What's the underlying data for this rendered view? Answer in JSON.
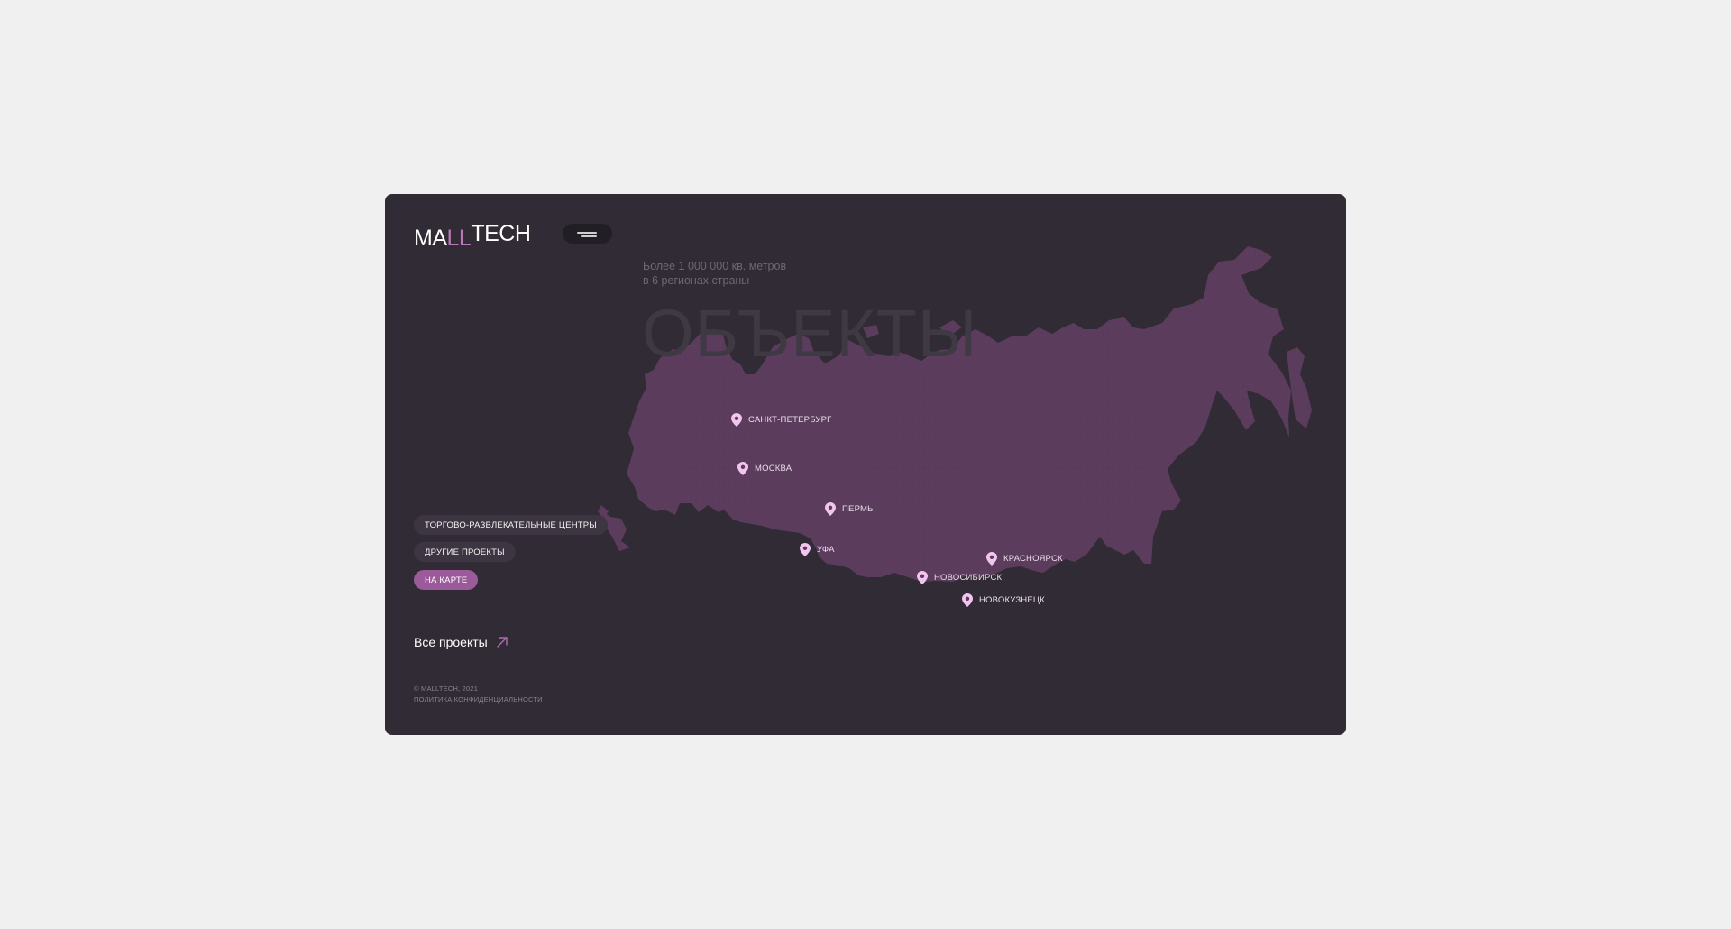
{
  "brand": {
    "logo_part1": "MA",
    "logo_part2": "LL",
    "logo_part3": "T",
    "logo_part4": "ECH",
    "accent_color": "#9b5a99",
    "map_color": "#5b3c5c"
  },
  "header": {
    "menu_icon": "hamburger-menu-icon"
  },
  "hero": {
    "subtitle_line1": "Более 1 000 000 кв. метров",
    "subtitle_line2": "в 6 регионах страны",
    "title": "ОБЪЕКТЫ"
  },
  "map": {
    "pin_icon": "map-pin-icon",
    "cities": [
      {
        "id": "spb",
        "label": "САНКТ-ПЕТЕРБУРГ"
      },
      {
        "id": "moscow",
        "label": "МОСКВА"
      },
      {
        "id": "perm",
        "label": "ПЕРМЬ"
      },
      {
        "id": "ufa",
        "label": "УФА"
      },
      {
        "id": "krasnoyarsk",
        "label": "КРАСНОЯРСК"
      },
      {
        "id": "novosibirsk",
        "label": "НОВОСИБИРСК"
      },
      {
        "id": "novokuznetsk",
        "label": "НОВОКУЗНЕЦК"
      }
    ]
  },
  "filters": [
    {
      "label": "ТОРГОВО-РАЗВЛЕКАТЕЛЬНЫЕ ЦЕНТРЫ",
      "active": false
    },
    {
      "label": "ДРУГИЕ ПРОЕКТЫ",
      "active": false
    },
    {
      "label": "НА КАРТЕ",
      "active": true
    }
  ],
  "all_projects": {
    "label": "Все проекты",
    "icon": "arrow-up-right-icon"
  },
  "footer": {
    "copyright": "© MALLTECH, 2021",
    "privacy": "ПОЛИТИКА КОНФИДЕНЦИАЛЬНОСТИ"
  }
}
